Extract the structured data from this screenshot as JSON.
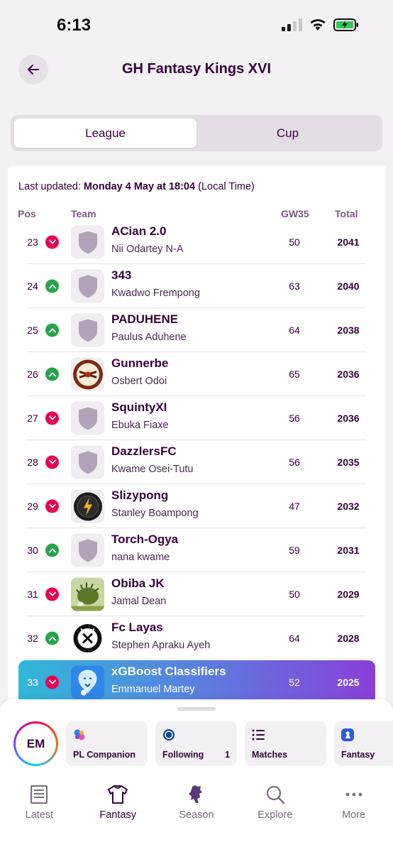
{
  "status": {
    "time": "6:13"
  },
  "header": {
    "title": "GH Fantasy Kings XVI"
  },
  "tabs": {
    "league": "League",
    "cup": "Cup"
  },
  "updated": {
    "prefix": "Last updated:",
    "when": "Monday 4 May at 18:04",
    "suffix": "(Local Time)"
  },
  "columns": {
    "pos": "Pos",
    "team": "Team",
    "gw": "GW35",
    "total": "Total"
  },
  "rows": [
    {
      "pos": "23",
      "trend": "down",
      "team": "ACian 2.0",
      "manager": "Nii Odartey N-A",
      "gw": "50",
      "total": "2041",
      "badge": "shield-icon"
    },
    {
      "pos": "24",
      "trend": "up",
      "team": "343",
      "manager": "Kwadwo Frempong",
      "gw": "63",
      "total": "2040",
      "badge": "shield-icon"
    },
    {
      "pos": "25",
      "trend": "up",
      "team": "PADUHENE",
      "manager": "Paulus Aduhene",
      "gw": "64",
      "total": "2038",
      "badge": "shield-icon"
    },
    {
      "pos": "26",
      "trend": "up",
      "team": "Gunnerbe",
      "manager": "Osbert Odoi",
      "gw": "65",
      "total": "2036",
      "badge": "gunners-crest-icon"
    },
    {
      "pos": "27",
      "trend": "down",
      "team": "SquintyXI",
      "manager": "Ebuka Fiaxe",
      "gw": "56",
      "total": "2036",
      "badge": "shield-icon"
    },
    {
      "pos": "28",
      "trend": "down",
      "team": "DazzlersFC",
      "manager": "Kwame Osei-Tutu",
      "gw": "56",
      "total": "2035",
      "badge": "shield-icon"
    },
    {
      "pos": "29",
      "trend": "down",
      "team": "Slizypong",
      "manager": "Stanley Boampong",
      "gw": "47",
      "total": "2032",
      "badge": "lightning-ball-icon"
    },
    {
      "pos": "30",
      "trend": "up",
      "team": "Torch-Ogya",
      "manager": "nana kwame",
      "gw": "59",
      "total": "2031",
      "badge": "shield-icon"
    },
    {
      "pos": "31",
      "trend": "down",
      "team": "Obiba JK",
      "manager": "Jamal Dean",
      "gw": "50",
      "total": "2029",
      "badge": "hedgehog-icon"
    },
    {
      "pos": "32",
      "trend": "up",
      "team": "Fc Layas",
      "manager": "Stephen Apraku Ayeh",
      "gw": "64",
      "total": "2028",
      "badge": "fc-crest-icon"
    },
    {
      "pos": "33",
      "trend": "down",
      "team": "xGBoost Classifiers",
      "manager": "Emmanuel Martey",
      "gw": "52",
      "total": "2025",
      "badge": "lion-icon",
      "highlight": true
    }
  ],
  "sheet": {
    "avatar": "EM",
    "quick": [
      {
        "label": "PL Companion",
        "icon": "copilot-icon"
      },
      {
        "label": "Following",
        "count": "1",
        "icon": "club-crest-icon"
      },
      {
        "label": "Matches",
        "icon": "list-icon"
      },
      {
        "label": "Fantasy",
        "icon": "pl-lion-icon"
      }
    ]
  },
  "nav": [
    {
      "label": "Latest",
      "icon": "news-icon"
    },
    {
      "label": "Fantasy",
      "icon": "shirt-icon",
      "active": true
    },
    {
      "label": "Season",
      "icon": "pl-lion-icon"
    },
    {
      "label": "Explore",
      "icon": "search-icon"
    },
    {
      "label": "More",
      "icon": "more-icon"
    }
  ],
  "colors": {
    "primary": "#37003c",
    "down": "#e90052",
    "up": "#26a44a"
  }
}
